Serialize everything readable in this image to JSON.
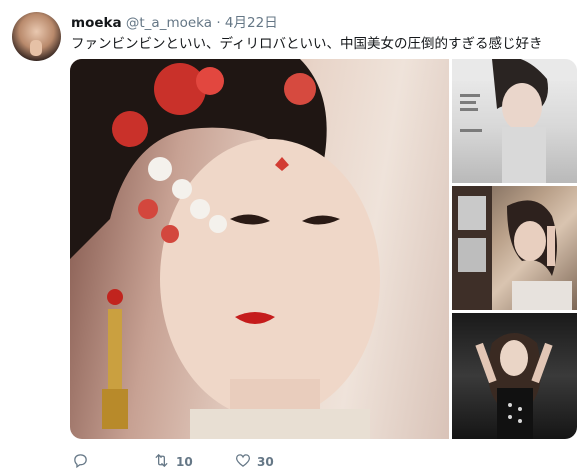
{
  "tweet": {
    "author": {
      "name": "moeka",
      "handle": "@t_a_moeka",
      "separator": "·",
      "time": "4月22日",
      "avatar_icon": "avatar-photo"
    },
    "text": "ファンビンビンといい、ディリロバといい、中国美女の圧倒的すぎる感じ好き",
    "media": [
      {
        "name": "photo-main"
      },
      {
        "name": "photo-magazine-cover"
      },
      {
        "name": "photo-window"
      },
      {
        "name": "photo-dark-dress"
      }
    ],
    "actions": {
      "reply": {
        "icon": "reply-icon",
        "count": ""
      },
      "retweet": {
        "icon": "retweet-icon",
        "count": "10"
      },
      "like": {
        "icon": "heart-icon",
        "count": "30"
      }
    }
  },
  "colors": {
    "text": "#14171a",
    "muted": "#657786"
  }
}
